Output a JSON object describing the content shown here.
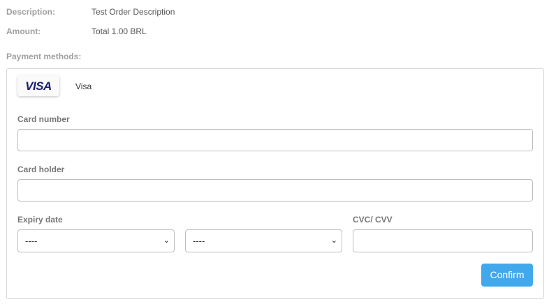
{
  "summary": {
    "description_label": "Description:",
    "description_value": "Test Order Description",
    "amount_label": "Amount:",
    "amount_value": "Total 1.00 BRL"
  },
  "payment": {
    "title": "Payment methods:",
    "method_logo": "VISA",
    "method_name": "Visa"
  },
  "form": {
    "card_number_label": "Card number",
    "card_number_value": "",
    "card_holder_label": "Card holder",
    "card_holder_value": "",
    "expiry_label": "Expiry date",
    "expiry_month": "----",
    "expiry_year": "----",
    "cvc_label": "CVC/ CVV",
    "cvc_value": "",
    "confirm_label": "Confirm"
  }
}
